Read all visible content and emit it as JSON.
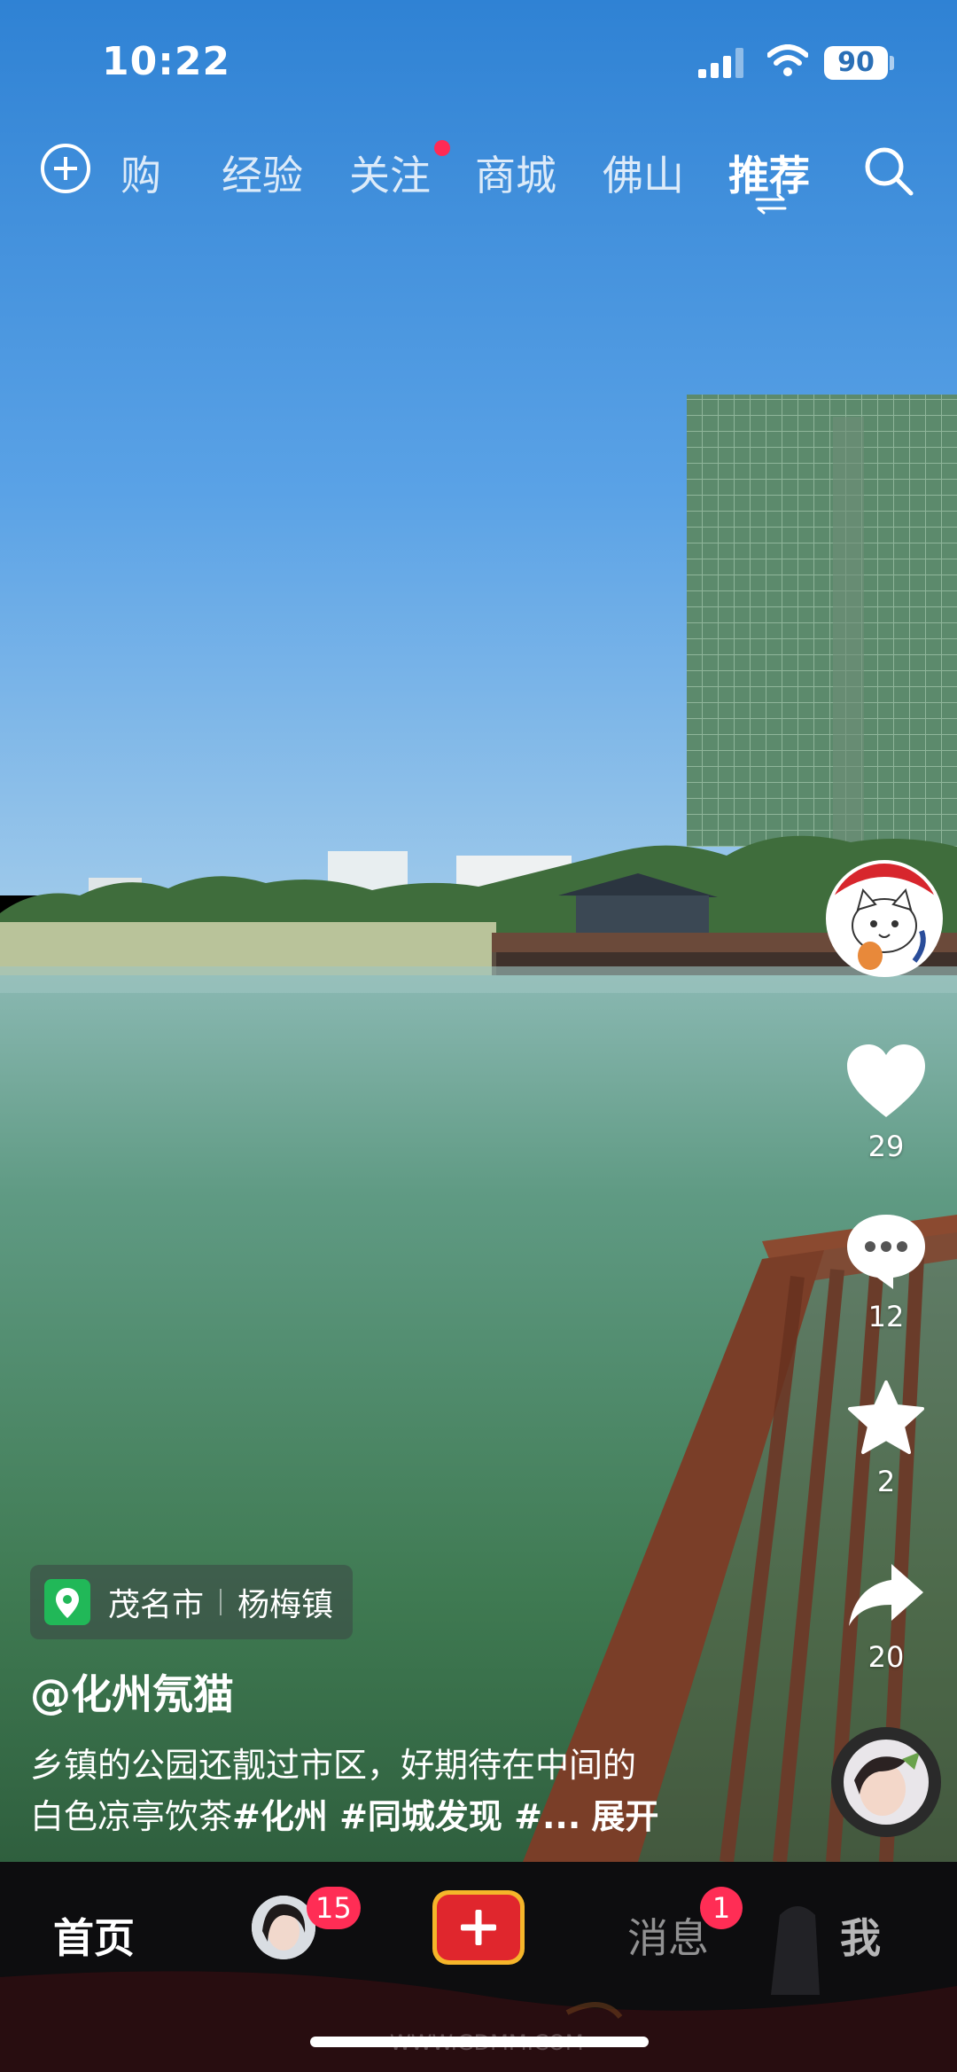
{
  "status_bar": {
    "time": "10:22",
    "battery": "90"
  },
  "top_nav": {
    "tabs": [
      {
        "label": "购",
        "active": false
      },
      {
        "label": "经验",
        "active": false
      },
      {
        "label": "关注",
        "active": false,
        "dot": true
      },
      {
        "label": "商城",
        "active": false
      },
      {
        "label": "佛山",
        "active": false
      },
      {
        "label": "推荐",
        "active": true
      }
    ]
  },
  "video": {
    "likes": "29",
    "comments": "12",
    "favorites": "2",
    "shares": "20",
    "location": {
      "city": "茂名市",
      "town": "杨梅镇"
    },
    "author": "@化州氖猫",
    "description_line1": "乡镇的公园还靓过市区，好期待在中间的",
    "description_line2_prefix": "白色凉亭饮茶",
    "description_tags": "#化州 #同城发现 #...",
    "expand_label": "展开"
  },
  "bottom_nav": {
    "home": "首页",
    "friends_badge": "15",
    "messages": "消息",
    "messages_badge": "1",
    "me": "我"
  },
  "watermark": "WWW.GDMM.COM"
}
